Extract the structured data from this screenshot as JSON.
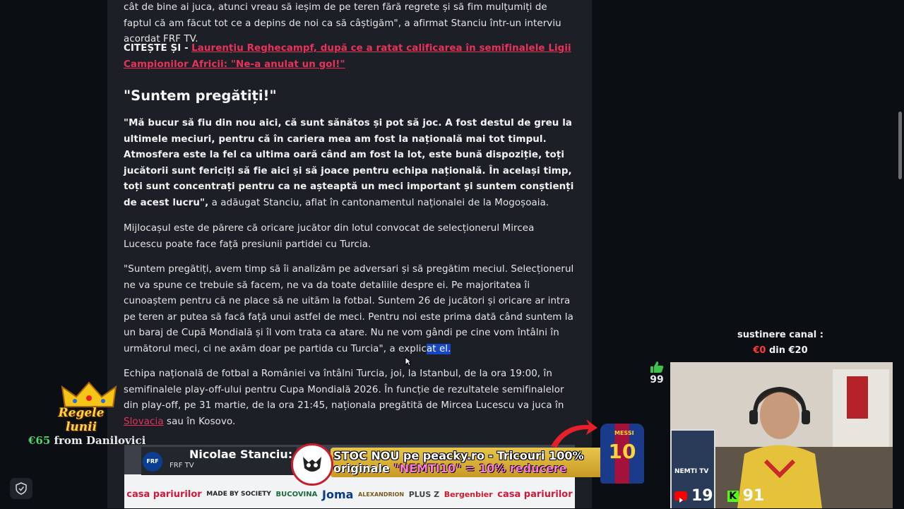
{
  "article": {
    "intro": "cât de bine ai juca, atunci vreau să ieșim de pe teren fără regrete și să fim mulțumiți de faptul că am făcut tot ce a depins de noi ca să câștigăm\", a afirmat Stanciu într-un interviu acordat FRF TV.",
    "read_also_label": "CITEȘTE ȘI -",
    "read_also_link": "Laurențiu Reghecampf, după ce a ratat calificarea în semifinalele Ligii Campionilor Africii: \"Ne-a anulat un gol!\"",
    "heading": "\"Suntem pregătiți!\"",
    "quote1_bold": "\"Mă bucur să fiu din nou aici, că sunt sănătos și pot să joc. A fost destul de greu la ultimele meciuri, pentru că în cariera mea am fost la națională mai tot timpul. Atmosfera este la fel ca ultima oară când am fost la lot, este bună dispoziție, toți jucătorii sunt fericiți să fie aici și să joace pentru echipa națională. În același timp, toți sunt concentrați pentru ca ne așteaptă un meci important și suntem conștienți de acest lucru\",",
    "quote1_rest": "a adăugat Stanciu, aflat în cantonamentul naționalei de la Mogoșoaia.",
    "para2": "Mijlocașul este de părere că oricare jucător din lotul convocat de selecționerul Mircea Lucescu poate face față presiunii partidei cu Turcia.",
    "para3_main": "\"Suntem pregătiți, avem timp să îi analizăm pe adversari și să pregătim meciul. Selecționerul ne va spune ce trebuie să facem, ne va da toate detaliile despre ei. Pe majoritatea îi cunoaștem pentru că ne place să ne uităm la fotbal. Suntem 26 de jucători și oricare ar intra pe teren ar putea să facă față unui astfel de meci. Pentru noi este prima dată când suntem la un baraj de Cupă Mondială și îl vom trata ca atare. Nu ne vom gândi pe cine vom întâlni în următorul meci, ci ne axăm doar pe partida cu Turcia\", a explic",
    "para3_selected": "at el.",
    "para4_main": "Echipa națională de fotbal a României va întâlni Turcia, joi, la Istanbul, de la ora 19:00, în semifinalele play-off-ului pentru Cupa Mondială 2026. În funcție de rezultatele semifinalelor din play-off, pe 31 martie, de la ora 21:45, naționala pregătită de Mircea Lucescu va juca în",
    "para4_link": "Slovacia",
    "para4_end": "sau în Kosovo."
  },
  "video": {
    "ticker_title": "Nicolae Stanciu: „Vom l",
    "ticker_source": "FRF TV",
    "frf_badge": "FRF",
    "sponsors": [
      "casa pariurilor",
      "MADE BY SOCIETY",
      "BUCOVINA",
      "Joma",
      "ALEXANDRION",
      "PLUS Z",
      "Bergenbier",
      "casa pariurilor"
    ]
  },
  "promo": {
    "line1": "STOC NOU pe peacky.ro - Tricouri 100%",
    "line2_start": "originale ",
    "line2_code": "\"NEMTI10\" = 10% reducere",
    "jersey_number": "10",
    "jersey_name": "MESSI"
  },
  "donation": {
    "title": "Regele lunii",
    "amount": "€65",
    "from_text": "from Danilovici"
  },
  "support": {
    "label": "sustinere canal :",
    "current": "€0",
    "goal_text": "din €20"
  },
  "likes": {
    "count": "99"
  },
  "stream_stats": {
    "youtube_count": "19",
    "kick_count": "91",
    "channel_tag": "NEMTI TV"
  },
  "colors": {
    "link": "#e8325a",
    "selection": "#1646c8",
    "article_bg": "#1c2026"
  }
}
